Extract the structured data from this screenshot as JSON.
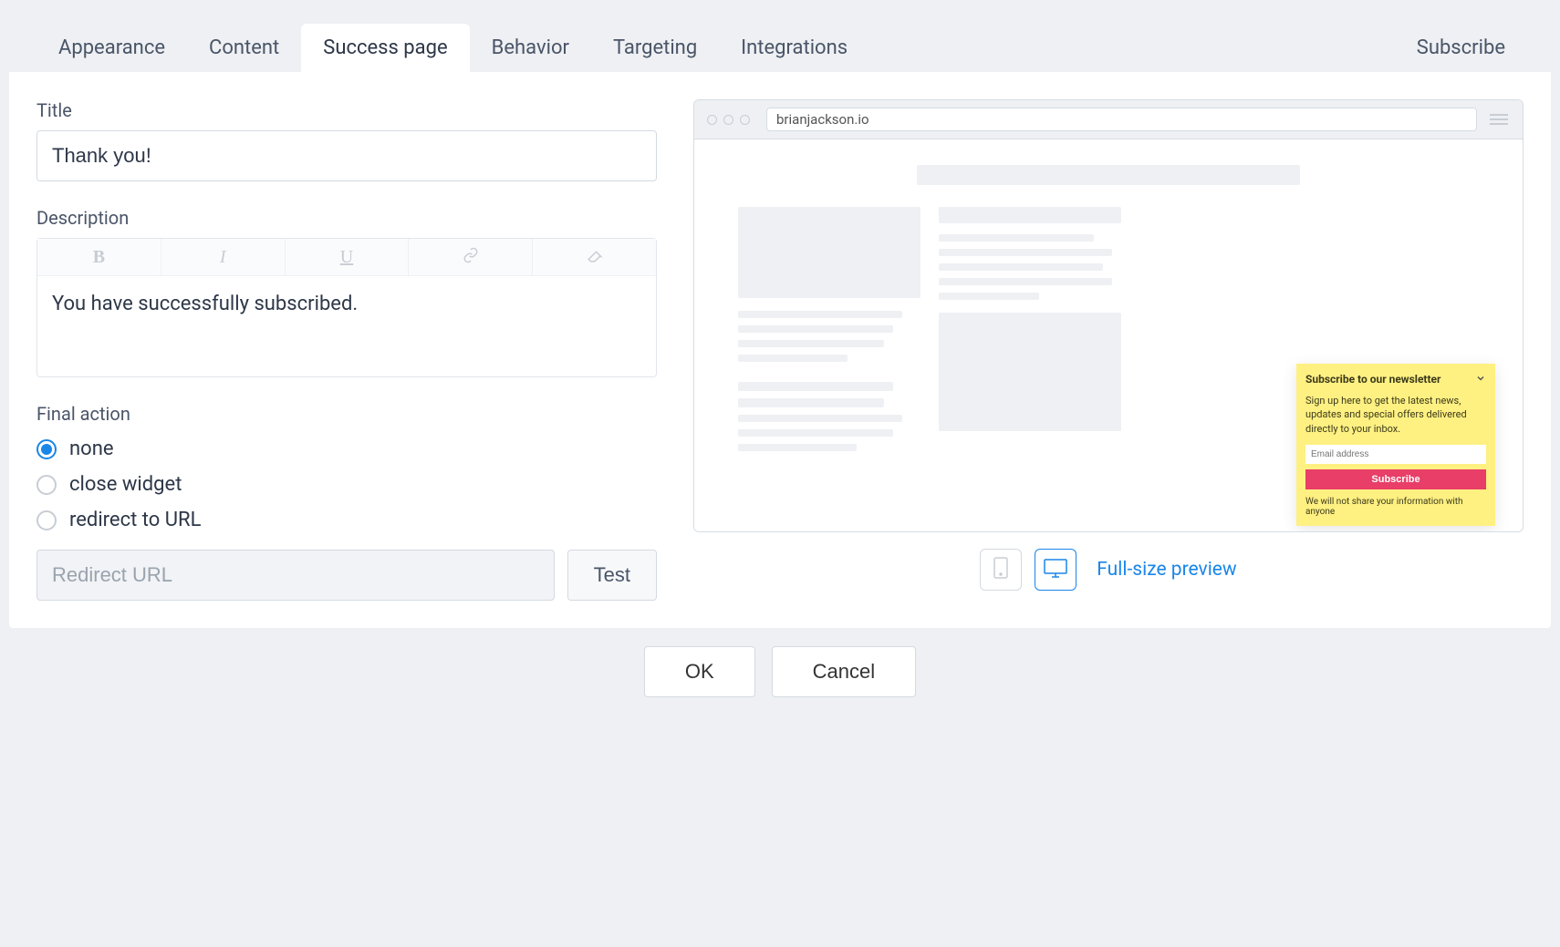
{
  "tabs": {
    "appearance": "Appearance",
    "content": "Content",
    "success_page": "Success page",
    "behavior": "Behavior",
    "targeting": "Targeting",
    "integrations": "Integrations",
    "subscribe": "Subscribe",
    "active": "success_page"
  },
  "form": {
    "title_label": "Title",
    "title_value": "Thank you!",
    "description_label": "Description",
    "description_value": "You have successfully subscribed.",
    "final_action_label": "Final action",
    "final_action_options": {
      "none": "none",
      "close_widget": "close widget",
      "redirect": "redirect to URL"
    },
    "final_action_selected": "none",
    "redirect_placeholder": "Redirect URL",
    "redirect_value": "",
    "test_label": "Test"
  },
  "preview": {
    "url": "brianjackson.io",
    "widget": {
      "title": "Subscribe to our newsletter",
      "body": "Sign up here to get the latest news, updates and special offers delivered directly to your inbox.",
      "email_placeholder": "Email address",
      "subscribe_label": "Subscribe",
      "footnote": "We will not share your information with anyone"
    },
    "fullsize_link": "Full-size preview"
  },
  "footer": {
    "ok": "OK",
    "cancel": "Cancel"
  },
  "colors": {
    "accent": "#1a86e8",
    "widget_bg": "#fff082",
    "widget_cta": "#e83e68"
  }
}
